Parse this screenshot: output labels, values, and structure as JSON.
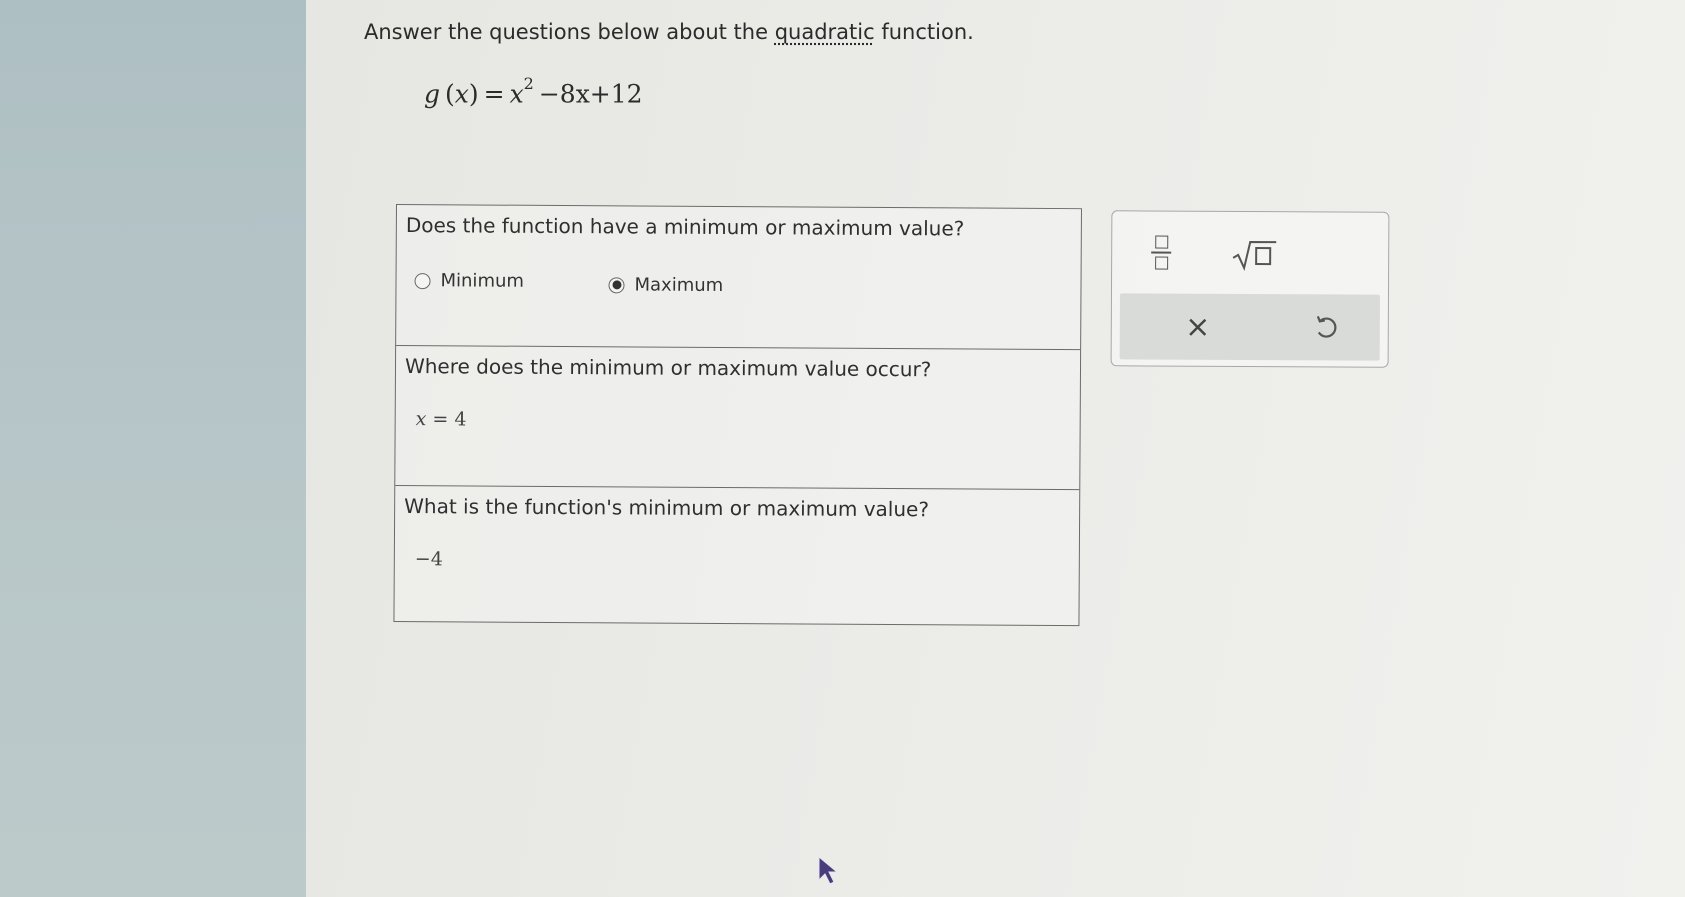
{
  "instruction": {
    "before": "Answer the questions below about the ",
    "link": "quadratic",
    "after": " function."
  },
  "equation": {
    "func": "g",
    "var": "x",
    "exp": "2",
    "rest": "−8x+12"
  },
  "questions": [
    {
      "text": "Does the function have a minimum or maximum value?",
      "options": [
        {
          "label": "Minimum",
          "selected": false
        },
        {
          "label": "Maximum",
          "selected": true
        }
      ]
    },
    {
      "text": "Where does the minimum or maximum value occur?",
      "answer": {
        "var": "x",
        "eq": " = ",
        "value": "4"
      }
    },
    {
      "text": "What is the function's minimum or maximum value?",
      "answer": {
        "value": "−4"
      }
    }
  ],
  "toolbar": {
    "clear_symbol": "×",
    "icons": [
      "fraction-icon",
      "square-root-icon",
      "close-icon",
      "undo-icon"
    ]
  }
}
